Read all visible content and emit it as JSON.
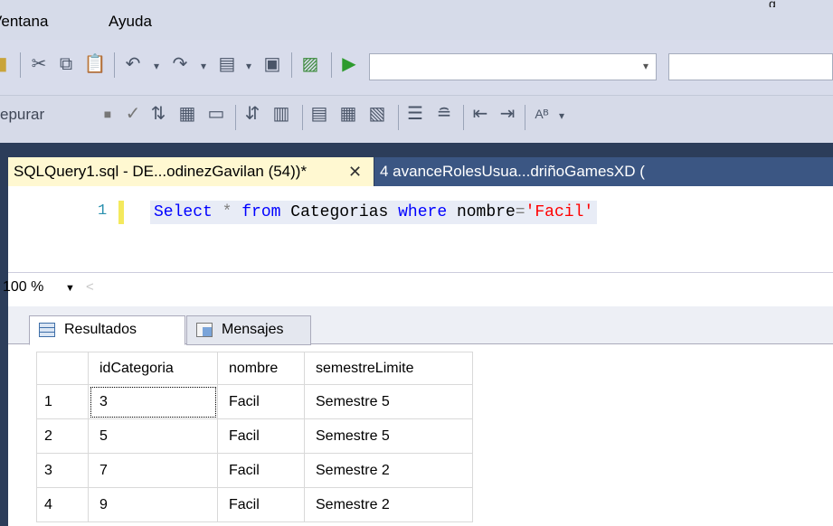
{
  "menu": {
    "items": [
      "Ventana",
      "Ayuda"
    ]
  },
  "toolbar2": {
    "partial_label": "epurar"
  },
  "document_tabs": [
    {
      "label": "SQLQuery1.sql - DE...odinezGavilan (54))*",
      "active": true,
      "close_glyph": "✕"
    },
    {
      "label": "4 avanceRolesUsua...driñoGamesXD (",
      "active": false
    }
  ],
  "editor": {
    "line_number": "1",
    "tokens": [
      "Select",
      "*",
      "from",
      "Categorias",
      "where",
      "nombre",
      "=",
      "'Facil'"
    ]
  },
  "zoom": {
    "value": "100 %"
  },
  "results_tabs": [
    {
      "label": "Resultados",
      "icon": "grid-icon",
      "active": true
    },
    {
      "label": "Mensajes",
      "icon": "messages-icon",
      "active": false
    }
  ],
  "results": {
    "columns": [
      "idCategoria",
      "nombre",
      "semestreLimite"
    ],
    "rows": [
      {
        "n": "1",
        "idCategoria": "3",
        "nombre": "Facil",
        "semestreLimite": "Semestre 5"
      },
      {
        "n": "2",
        "idCategoria": "5",
        "nombre": "Facil",
        "semestreLimite": "Semestre 5"
      },
      {
        "n": "3",
        "idCategoria": "7",
        "nombre": "Facil",
        "semestreLimite": "Semestre 2"
      },
      {
        "n": "4",
        "idCategoria": "9",
        "nombre": "Facil",
        "semestreLimite": "Semestre 2"
      }
    ]
  },
  "colors": {
    "keyword": "#0000ff",
    "string": "#ff0000",
    "operator": "#808080",
    "active_tab": "#fff8d1",
    "inactive_tab": "#3b5683",
    "chrome_background": "#2c3d5a"
  }
}
